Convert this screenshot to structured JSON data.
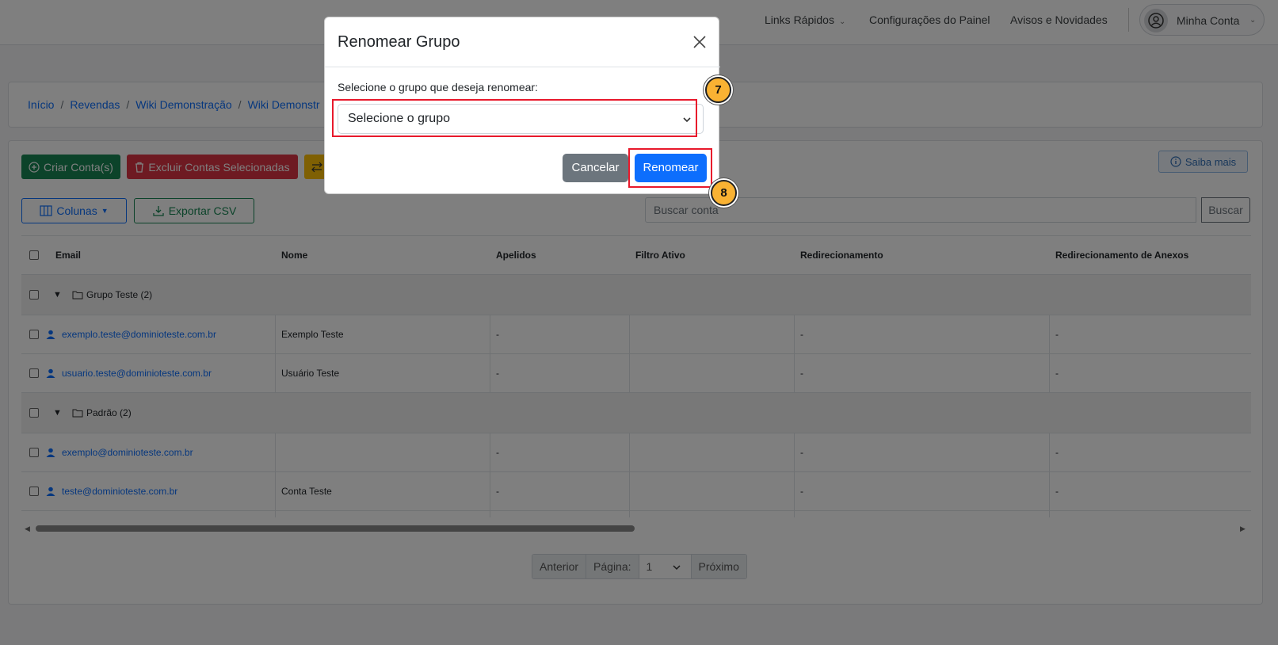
{
  "navbar": {
    "quick_links": "Links Rápidos",
    "panel_settings": "Configurações do Painel",
    "news": "Avisos e Novidades",
    "account": "Minha Conta"
  },
  "breadcrumb": [
    "Início",
    "Revendas",
    "Wiki Demonstração",
    "Wiki Demonstr"
  ],
  "toolbar": {
    "create_account": "Criar Conta(s)",
    "delete_selected": "Excluir Contas Selecionadas",
    "learn_more": "Saiba mais",
    "columns": "Colunas",
    "export_csv": "Exportar CSV",
    "search_placeholder": "Buscar conta",
    "search_button": "Buscar"
  },
  "table": {
    "headers": [
      "Email",
      "Nome",
      "Apelidos",
      "Filtro Ativo",
      "Redirecionamento",
      "Redirecionamento de Anexos"
    ],
    "groups": [
      {
        "label": "Grupo Teste (2)",
        "rows": [
          {
            "email": "exemplo.teste@dominioteste.com.br",
            "name": "Exemplo Teste",
            "aliases": "-",
            "filter": "",
            "redirect": "-",
            "attach_redirect": "-"
          },
          {
            "email": "usuario.teste@dominioteste.com.br",
            "name": "Usuário Teste",
            "aliases": "-",
            "filter": "",
            "redirect": "-",
            "attach_redirect": "-"
          }
        ]
      },
      {
        "label": "Padrão (2)",
        "rows": [
          {
            "email": "exemplo@dominioteste.com.br",
            "name": "",
            "aliases": "-",
            "filter": "",
            "redirect": "-",
            "attach_redirect": "-"
          },
          {
            "email": "teste@dominioteste.com.br",
            "name": "Conta Teste",
            "aliases": "-",
            "filter": "",
            "redirect": "-",
            "attach_redirect": "-"
          }
        ]
      }
    ]
  },
  "pagination": {
    "previous": "Anterior",
    "page_label": "Página:",
    "page_value": "1",
    "next": "Próximo"
  },
  "modal": {
    "title": "Renomear Grupo",
    "label": "Selecione o grupo que deseja renomear:",
    "select_value": "Selecione o grupo",
    "cancel": "Cancelar",
    "confirm": "Renomear"
  },
  "steps": {
    "select_step": "7",
    "confirm_step": "8"
  },
  "colors": {
    "primary": "#0d6efd",
    "success": "#198754",
    "danger": "#dc3545",
    "secondary": "#6c757d",
    "highlight": "#e8192c",
    "step_badge": "#f9b233"
  }
}
